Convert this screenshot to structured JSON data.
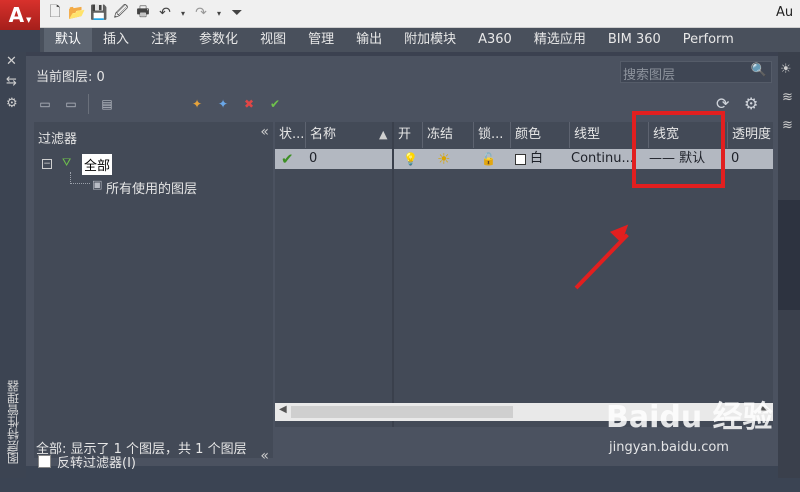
{
  "app": {
    "logo": "A",
    "title": "Au"
  },
  "quick_access": {
    "icons": [
      "new-icon",
      "open-icon",
      "save-icon",
      "save-as-icon",
      "print-icon",
      "undo-icon",
      "redo-icon",
      "customize-icon"
    ]
  },
  "ribbon": {
    "tabs": [
      "默认",
      "插入",
      "注释",
      "参数化",
      "视图",
      "管理",
      "输出",
      "附加模块",
      "A360",
      "精选应用",
      "BIM 360",
      "Perform"
    ],
    "active": "默认"
  },
  "palette": {
    "title_vertical": "图层特性管理器",
    "current_layer_label": "当前图层: 0",
    "search_placeholder": "搜索图层"
  },
  "filters": {
    "header": "过滤器",
    "collapse_glyph": "«",
    "tree": {
      "root_label": "全部",
      "root_expander": "−",
      "child_label": "所有使用的图层"
    },
    "invert_label": "反转过滤器(I)"
  },
  "layer_table": {
    "columns": [
      "状...",
      "名称",
      "开",
      "冻结",
      "锁...",
      "颜色",
      "线型",
      "线宽",
      "透明度"
    ],
    "rows": [
      {
        "status": "✔",
        "name": "0",
        "on": "💡",
        "freeze": "☀",
        "lock": "🔓",
        "color": "白",
        "linetype": "Continu...",
        "lineweight": "—— 默认",
        "transparency": "0"
      }
    ]
  },
  "status_text": "全部: 显示了 1 个图层，共 1 个图层",
  "watermark": {
    "logo": "Baidu 经验",
    "url": "jingyan.baidu.com"
  },
  "annotation": {
    "color": "#e21f1f"
  }
}
